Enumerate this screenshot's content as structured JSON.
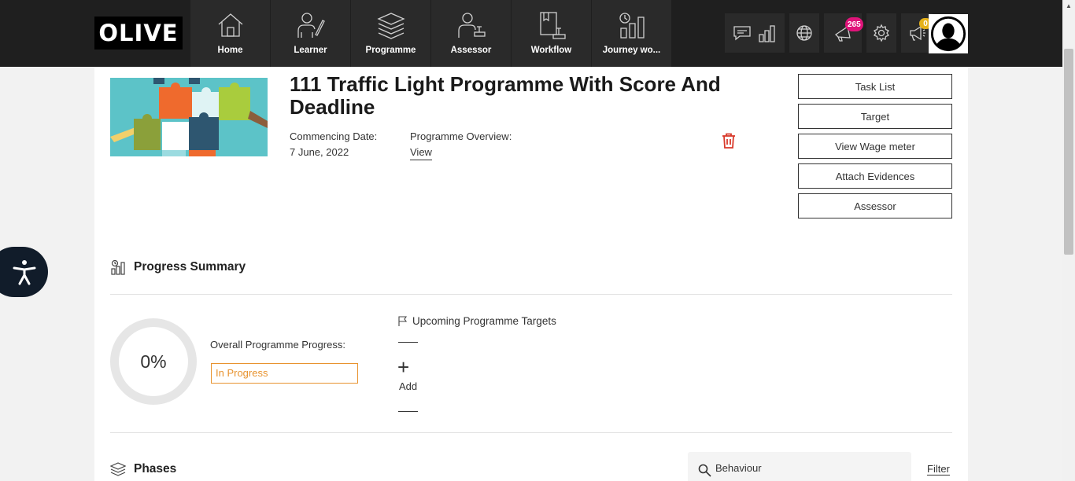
{
  "brand": {
    "logo_text": "OLIVE"
  },
  "nav": {
    "tabs": [
      {
        "label": "Home",
        "icon": "home-icon"
      },
      {
        "label": "Learner",
        "icon": "learner-icon"
      },
      {
        "label": "Programme",
        "icon": "programme-icon"
      },
      {
        "label": "Assessor",
        "icon": "assessor-icon"
      },
      {
        "label": "Workflow",
        "icon": "workflow-icon"
      },
      {
        "label": "Journey wo...",
        "icon": "journey-icon"
      }
    ]
  },
  "header_icons": {
    "notifications_count": "265",
    "announcements_count": "0",
    "notifications_badge_color": "#e0147a",
    "announcements_badge_color": "#e5b11a"
  },
  "programme": {
    "title": "111 Traffic Light Programme With Score And Deadline",
    "commencing_label": "Commencing Date:",
    "commencing_value": "7 June, 2022",
    "overview_label": "Programme Overview:",
    "overview_link": "View"
  },
  "side_buttons": {
    "task_list": "Task List",
    "target": "Target",
    "wage_meter": "View Wage meter",
    "attach_evidences": "Attach Evidences",
    "assessor": "Assessor"
  },
  "progress": {
    "section_title": "Progress Summary",
    "percent": "0%",
    "overall_label": "Overall Programme Progress:",
    "status": "In Progress",
    "status_color": "#e8932f",
    "upcoming_title": "Upcoming Programme Targets",
    "add_label": "Add"
  },
  "phases": {
    "section_title": "Phases",
    "search_value": "Behaviour",
    "filter_label": "Filter"
  }
}
